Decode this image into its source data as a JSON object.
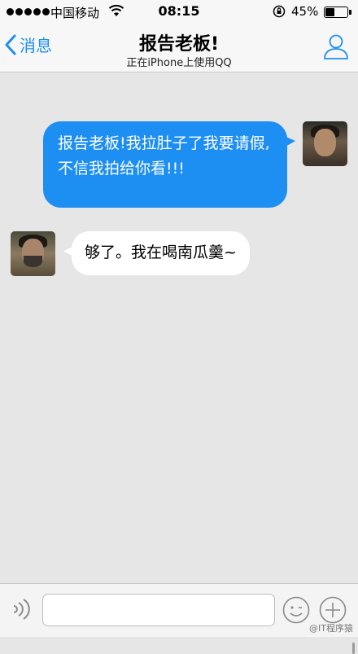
{
  "status_bar": {
    "carrier": "中国移动",
    "time": "08:15",
    "battery_percent": "45%",
    "battery_level": 0.45,
    "icons": [
      "signal-dots-icon",
      "wifi-icon",
      "rotation-lock-icon",
      "battery-icon"
    ]
  },
  "nav": {
    "back_label": "消息",
    "title": "报告老板!",
    "subtitle": "正在iPhone上使用QQ",
    "icons": [
      "back-chevron-icon",
      "profile-icon"
    ]
  },
  "messages": [
    {
      "side": "right",
      "text": "报告老板!我拉肚子了我要请假,不信我拍给你看!!!"
    },
    {
      "side": "left",
      "text": "够了。我在喝南瓜羹~"
    }
  ],
  "input_bar": {
    "value": "",
    "icons": [
      "voice-icon",
      "emoji-icon",
      "plus-icon"
    ]
  },
  "watermark": "@IT程序猿",
  "colors": {
    "accent": "#1d8ef2",
    "chat_background": "#e6e6e6",
    "incoming_bubble": "#ffffff"
  }
}
